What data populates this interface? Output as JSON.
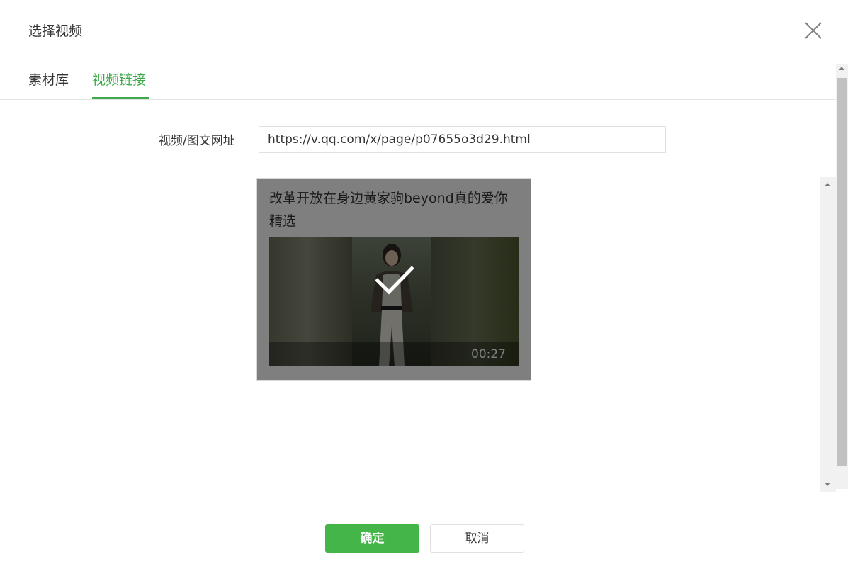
{
  "dialog": {
    "title": "选择视频"
  },
  "tabs": [
    {
      "label": "素材库",
      "active": false
    },
    {
      "label": "视频链接",
      "active": true
    }
  ],
  "form": {
    "url_label": "视频/图文网址",
    "url_value": "https://v.qq.com/x/page/p07655o3d29.html"
  },
  "video": {
    "title": "改革开放在身边黄家驹beyond真的爱你精选",
    "duration": "00:27",
    "selected": true
  },
  "buttons": {
    "confirm": "确定",
    "cancel": "取消"
  },
  "colors": {
    "accent": "#3fa84a",
    "confirm_bg": "#44b549"
  },
  "icons": {
    "close": "close-icon",
    "check": "check-icon"
  }
}
